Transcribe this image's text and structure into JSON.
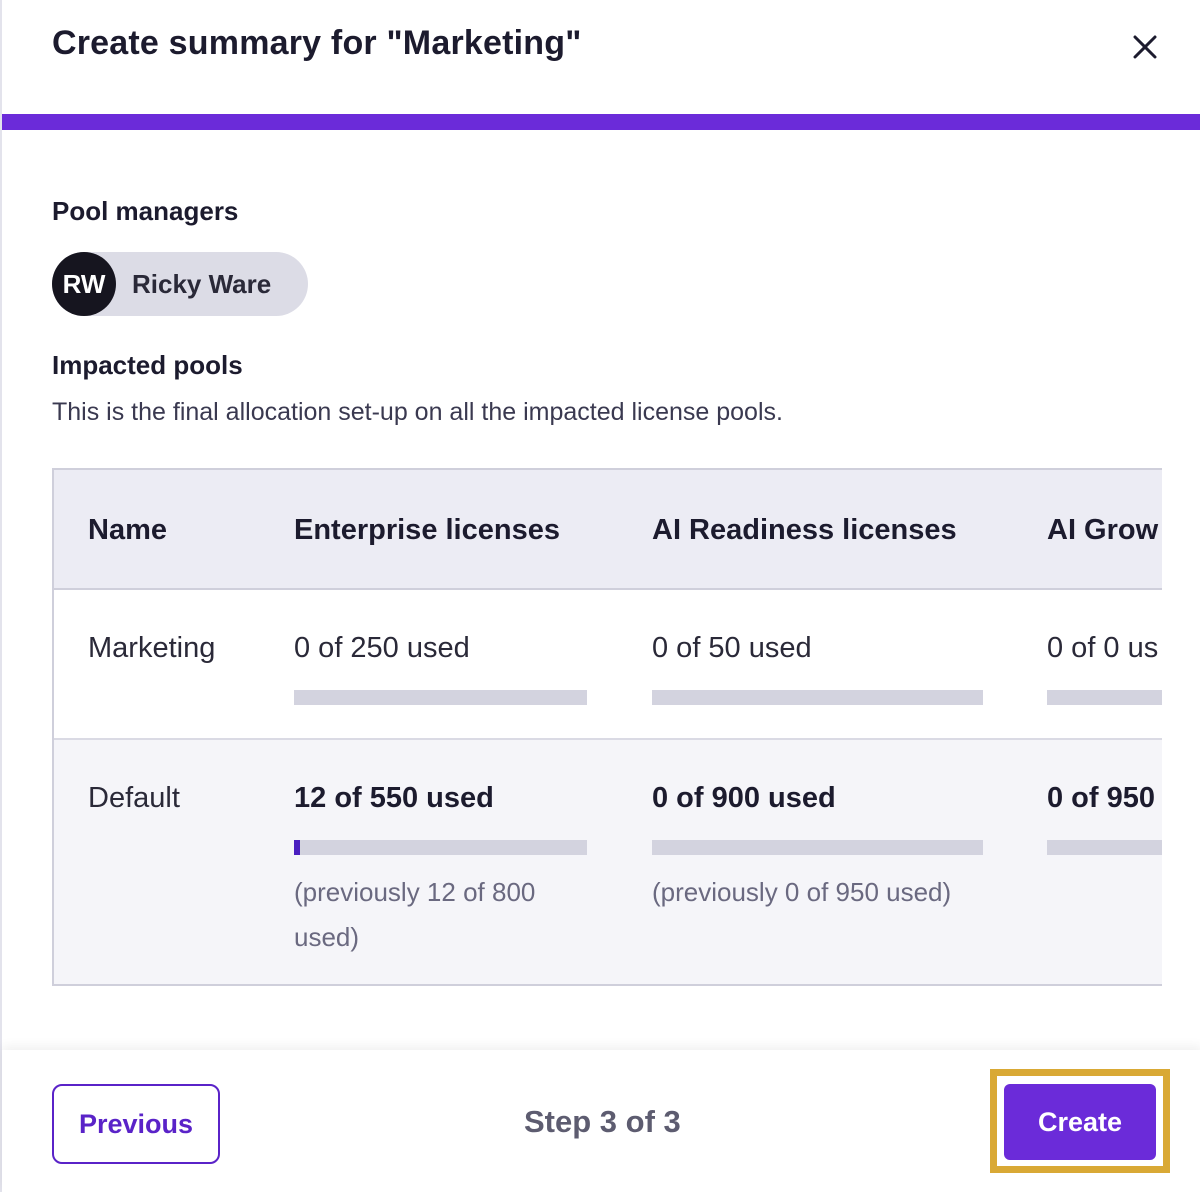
{
  "dialog": {
    "title": "Create summary for \"Marketing\"",
    "close_icon": "close-icon",
    "accent_color": "#6b2bd9"
  },
  "pool_managers": {
    "label": "Pool managers",
    "managers": [
      {
        "initials": "RW",
        "name": "Ricky Ware"
      }
    ]
  },
  "impacted_pools": {
    "label": "Impacted pools",
    "description": "This is the final allocation set-up on all the impacted license pools."
  },
  "table": {
    "columns": [
      "Name",
      "Enterprise licenses",
      "AI Readiness licenses",
      "AI Grow"
    ],
    "rows": [
      {
        "name": "Marketing",
        "cells": [
          {
            "used": "0 of 250 used",
            "fraction": 0
          },
          {
            "used": "0 of 50 used",
            "fraction": 0
          },
          {
            "used": "0 of 0 us",
            "fraction": 0
          }
        ]
      },
      {
        "name": "Default",
        "cells": [
          {
            "used": "12 of 550 used",
            "fraction": 0.0218,
            "previous": "(previously 12 of 800 used)"
          },
          {
            "used": "0 of 900 used",
            "fraction": 0,
            "previous": "(previously 0 of 950 used)"
          },
          {
            "used": "0 of 950",
            "fraction": 0
          }
        ]
      }
    ]
  },
  "footer": {
    "previous_label": "Previous",
    "step_label": "Step 3 of 3",
    "create_label": "Create"
  }
}
